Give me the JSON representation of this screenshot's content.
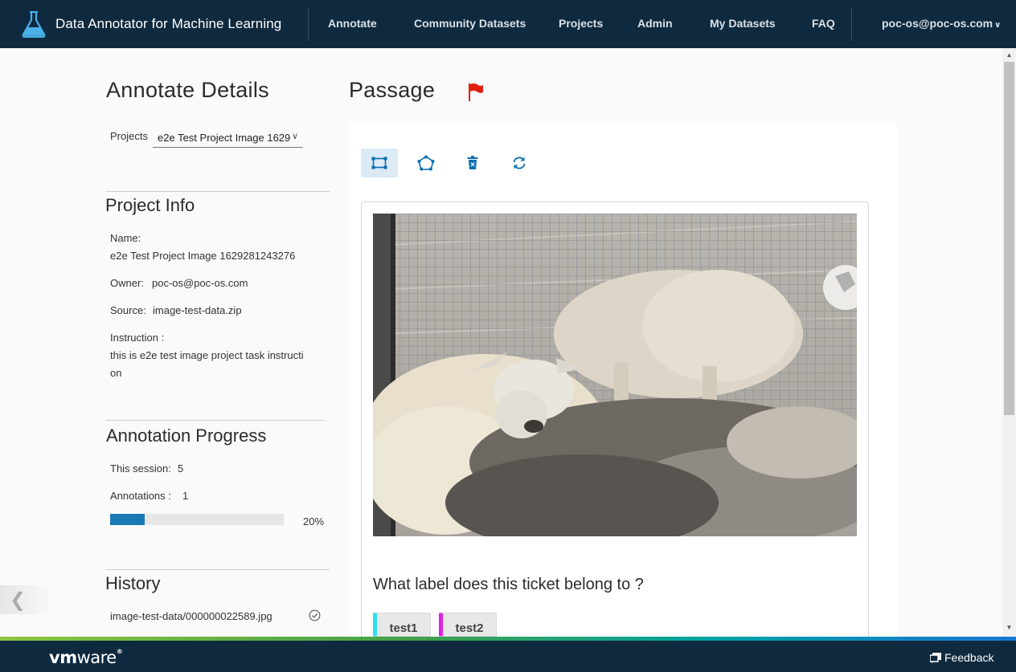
{
  "header": {
    "app_title": "Data Annotator for Machine Learning",
    "nav": [
      "Annotate",
      "Community Datasets",
      "Projects",
      "Admin",
      "My Datasets",
      "FAQ"
    ],
    "user": "poc-os@poc-os.com"
  },
  "left": {
    "title": "Annotate Details",
    "projects_label": "Projects",
    "project_selected": "e2e Test Project Image 1629",
    "project_info": {
      "heading": "Project Info",
      "name_label": "Name:",
      "name_value": "e2e Test Project Image 1629281243276",
      "owner_label": "Owner:",
      "owner_value": "poc-os@poc-os.com",
      "source_label": "Source:",
      "source_value": "image-test-data.zip",
      "instruction_label": "Instruction :",
      "instruction_line1": "this is e2e test image project task instructi",
      "instruction_line2": "on"
    },
    "progress": {
      "heading": "Annotation Progress",
      "session_label": "This session:",
      "session_value": "5",
      "annotations_label": "Annotations :",
      "annotations_value": "1",
      "percent_text": "20%",
      "fraction": 0.2
    },
    "history": {
      "heading": "History",
      "items": [
        "image-test-data/000000022589.jpg"
      ]
    }
  },
  "main": {
    "title": "Passage",
    "tools": [
      "rectangle-tool-icon",
      "polygon-tool-icon",
      "delete-icon",
      "reset-icon"
    ],
    "question": "What label does this ticket belong to ?",
    "labels": [
      {
        "text": "test1",
        "color": "#2de0f0"
      },
      {
        "text": "test2",
        "color": "#e020e8"
      }
    ]
  },
  "footer": {
    "logo": "vmware",
    "feedback": "Feedback"
  },
  "colors": {
    "header_bg": "#0f2a3f",
    "accent": "#1a78b4",
    "flag": "#e02010"
  }
}
